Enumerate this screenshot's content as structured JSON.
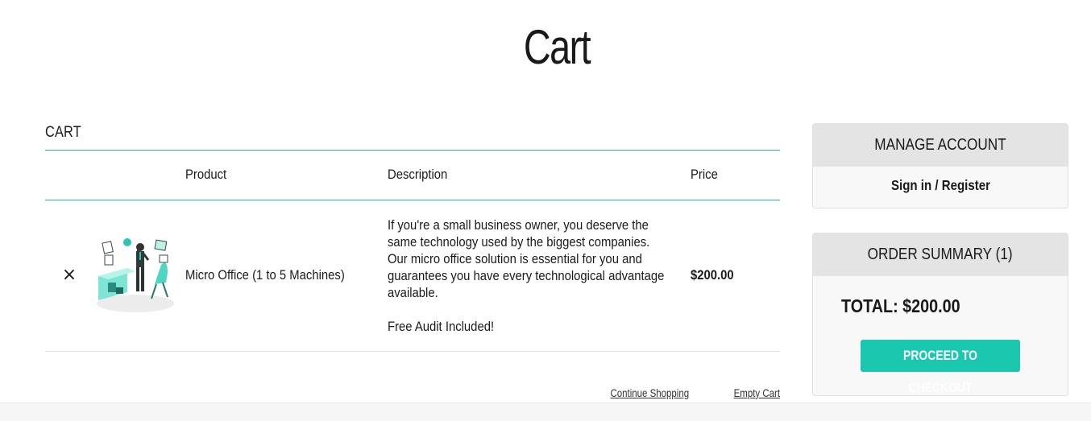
{
  "page": {
    "title": "Cart"
  },
  "cart": {
    "heading": "CART",
    "columns": {
      "product": "Product",
      "description": "Description",
      "price": "Price"
    },
    "items": [
      {
        "remove_label": "×",
        "image": "office-illustration",
        "name": "Micro Office (1 to 5 Machines)",
        "description": "If you're a small business owner, you deserve the\nsame technology used by the biggest companies.\nOur micro office solution is essential for you and\nguarantees you have every technological advantage\navailable.",
        "note": "Free Audit Included!",
        "price": "$200.00"
      }
    ],
    "continue_label": "Continue Shopping",
    "empty_label": "Empty Cart"
  },
  "account": {
    "title": "MANAGE ACCOUNT",
    "signin_label": "Sign in / Register"
  },
  "summary": {
    "title": "ORDER SUMMARY (1)",
    "total": "TOTAL: $200.00",
    "checkout_label": "PROCEED TO CHECKOUT"
  },
  "colors": {
    "accent": "#20b2a6",
    "button": "#1cc7b0",
    "panel_header": "#e4e4e4"
  }
}
